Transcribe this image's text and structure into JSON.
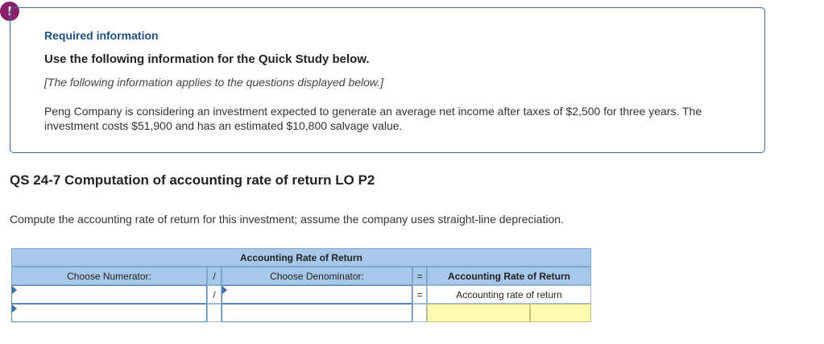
{
  "alert": {
    "symbol": "!"
  },
  "info": {
    "title": "Required information",
    "use_line": "Use the following information for the Quick Study below.",
    "note": "[The following information applies to the questions displayed below.]",
    "scenario": "Peng Company is considering an investment expected to generate an average net income after taxes of $2,500 for three years. The investment costs $51,900 and has an estimated $10,800 salvage value."
  },
  "question": {
    "title": "QS 24-7 Computation of accounting rate of return LO P2",
    "instruction": "Compute the accounting rate of return for this investment; assume the company uses straight-line depreciation."
  },
  "table": {
    "header_title": "Accounting Rate of Return",
    "numerator_label": "Choose Numerator:",
    "divide_symbol": "/",
    "denominator_label": "Choose Denominator:",
    "equals_symbol": "=",
    "result_label": "Accounting Rate of Return",
    "result_row_label": "Accounting rate of return",
    "numerator_value": "",
    "denominator_value": "",
    "numerator2_value": "",
    "denominator2_value": "",
    "answer_value": "",
    "answer_pct": ""
  },
  "colors": {
    "header_bg": "#a8c8ea",
    "answer_bg": "#fffbb0",
    "title_blue": "#1f4f82",
    "alert": "#8a1f6b"
  },
  "icons": {
    "alert": "exclamation-circle-icon"
  }
}
